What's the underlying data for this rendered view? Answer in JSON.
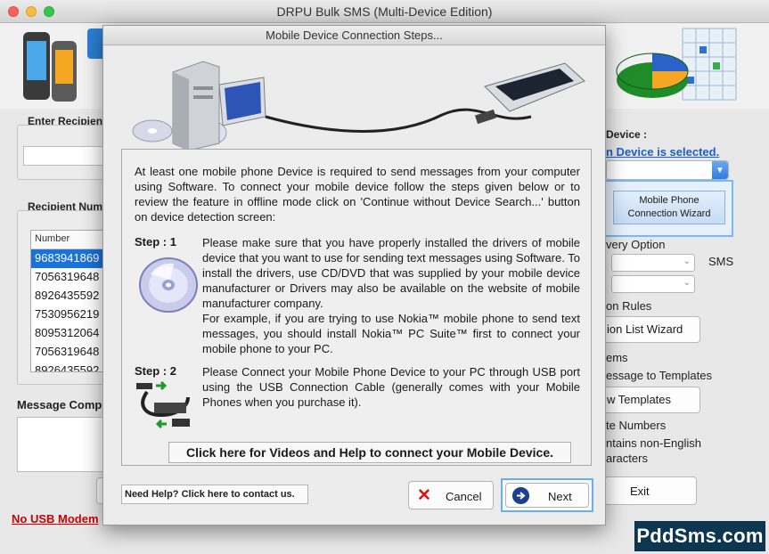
{
  "app": {
    "title": "DRPU Bulk SMS (Multi-Device Edition)"
  },
  "background": {
    "enter_recipient_label": "Enter Recipient",
    "recipient_numbers_label": "Recipient Numb",
    "number_column_header": "Number",
    "numbers": [
      "9683941869",
      "7056319648",
      "8926435592",
      "7530956219",
      "8095312064",
      "7056319648",
      "8926435592"
    ],
    "message_composer_label": "Message Compo",
    "no_usb_modem_text": "No USB Modem",
    "device_label": "Device :",
    "device_link": "n Device is selected.",
    "wizard_button_line1": "Mobile Phone",
    "wizard_button_line2": "Connection  Wizard",
    "delivery_option_label": "very Option",
    "sms_label": "SMS",
    "rules_label": "on Rules",
    "list_wizard_button": "ion List Wizard",
    "items_label": "ems",
    "save_templates_text": "essage to Templates",
    "view_templates_button": "w Templates",
    "numbers_note": "te Numbers",
    "non_english_line1": "ntains non-English",
    "non_english_line2": "aracters",
    "exit_button": "Exit",
    "watermark": "PddSms.com"
  },
  "dialog": {
    "title": "Mobile Device Connection Steps...",
    "intro": "At least one mobile phone Device is required to send messages from your computer using Software.  To connect your mobile device follow the steps given below or to review the feature in offline mode click on 'Continue without Device Search...' button on device detection screen:",
    "step1_label": "Step : 1",
    "step1_text_a": "Please make sure that you have properly installed the drivers of mobile device that you want to use for sending text messages using Software. To install the drivers, use CD/DVD that was supplied by your mobile device manufacturer or Drivers may also be available on the website of mobile manufacturer company.",
    "step1_text_b": "For example, if you are trying to use Nokia™ mobile phone to send text messages, you should install Nokia™ PC Suite™ first to connect your mobile phone to your PC.",
    "step2_label": "Step : 2",
    "step2_text": "Please Connect your Mobile Phone Device to your PC through USB port using the USB Connection Cable (generally comes with your Mobile Phones when you purchase it).",
    "videos_help_button": "Click here for Videos and Help to connect your Mobile Device.",
    "need_help_button": "Need Help? Click here to contact us.",
    "cancel_button": "Cancel",
    "next_button": "Next"
  },
  "colors": {
    "selection": "#1a73d9",
    "link": "#1a5fcc",
    "error_text": "#cc0000",
    "focus_ring": "#6aaef0",
    "watermark_bg": "#0d3750"
  }
}
